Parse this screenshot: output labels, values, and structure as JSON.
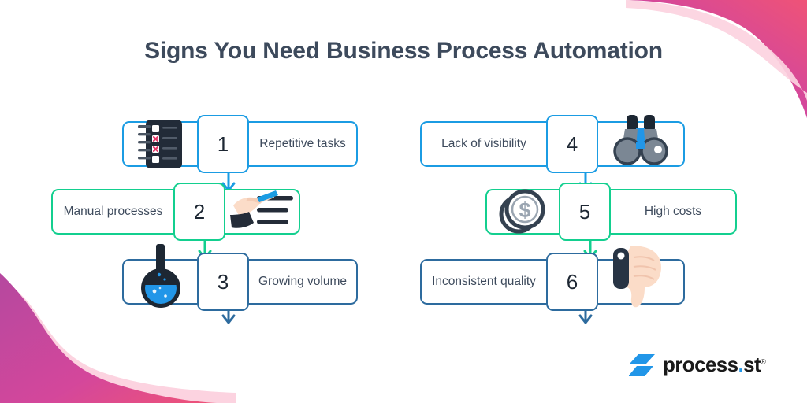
{
  "header": {
    "title": "Signs You Need Business Process Automation"
  },
  "colors": {
    "title": "#3d4a5c",
    "blue": "#1b9ce3",
    "green": "#13cf8f",
    "navy": "#2d6b9e",
    "pink_light": "#fcd3e0",
    "magenta": "#b5489f",
    "pink": "#e8527f",
    "logo_blue": "#2196e8",
    "text": "#3d4a5c"
  },
  "columns": [
    {
      "name": "left-column",
      "rows": [
        {
          "number": "1",
          "label": "Repetitive tasks",
          "icon": "checklist-notepad-icon",
          "color": "blue",
          "icon_side": "left",
          "has_arrow": true,
          "arrow_color": "blue"
        },
        {
          "number": "2",
          "label": "Manual processes",
          "icon": "hand-writing-pen-icon",
          "color": "green",
          "icon_side": "right",
          "has_arrow": true,
          "arrow_color": "green"
        },
        {
          "number": "3",
          "label": "Growing volume",
          "icon": "flask-beaker-icon",
          "color": "navy",
          "icon_side": "left",
          "has_arrow": true,
          "arrow_color": "navy"
        }
      ]
    },
    {
      "name": "right-column",
      "rows": [
        {
          "number": "4",
          "label": "Lack of visibility",
          "icon": "binoculars-icon",
          "color": "blue",
          "icon_side": "right",
          "has_arrow": true,
          "arrow_color": "blue"
        },
        {
          "number": "5",
          "label": "High costs",
          "icon": "dollar-coins-icon",
          "color": "green",
          "icon_side": "left",
          "has_arrow": true,
          "arrow_color": "green"
        },
        {
          "number": "6",
          "label": "Inconsistent quality",
          "icon": "thumbs-down-icon",
          "color": "navy",
          "icon_side": "right",
          "has_arrow": true,
          "arrow_color": "navy"
        }
      ]
    }
  ],
  "logo": {
    "name": "process.st",
    "word": "process",
    "dot": ".",
    "suffix": "st",
    "registered": "®"
  }
}
